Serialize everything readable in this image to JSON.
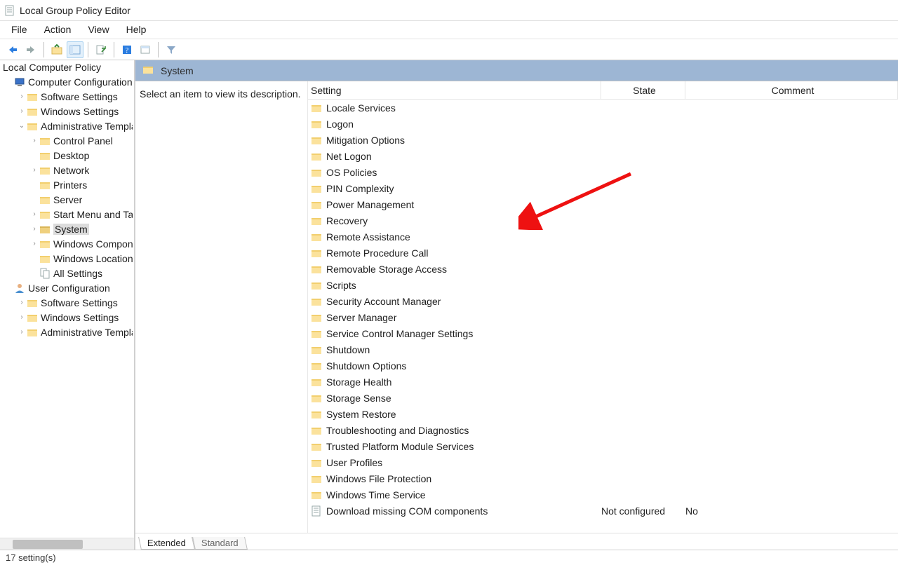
{
  "window_title": "Local Group Policy Editor",
  "menubar": [
    "File",
    "Action",
    "View",
    "Help"
  ],
  "tree_header": "Local Computer Policy",
  "tree": [
    {
      "lvl": 1,
      "exp": "",
      "icon": "computer",
      "label": "Computer Configuration"
    },
    {
      "lvl": 2,
      "exp": "closed",
      "icon": "folder",
      "label": "Software Settings"
    },
    {
      "lvl": 2,
      "exp": "closed",
      "icon": "folder",
      "label": "Windows Settings"
    },
    {
      "lvl": 2,
      "exp": "open",
      "icon": "folder",
      "label": "Administrative Templates"
    },
    {
      "lvl": 3,
      "exp": "closed",
      "icon": "folder",
      "label": "Control Panel"
    },
    {
      "lvl": 3,
      "exp": "",
      "icon": "folder",
      "label": "Desktop"
    },
    {
      "lvl": 3,
      "exp": "closed",
      "icon": "folder",
      "label": "Network"
    },
    {
      "lvl": 3,
      "exp": "",
      "icon": "folder",
      "label": "Printers"
    },
    {
      "lvl": 3,
      "exp": "",
      "icon": "folder",
      "label": "Server"
    },
    {
      "lvl": 3,
      "exp": "closed",
      "icon": "folder",
      "label": "Start Menu and Taskbar"
    },
    {
      "lvl": 3,
      "exp": "closed",
      "icon": "folder",
      "label": "System",
      "selected": true
    },
    {
      "lvl": 3,
      "exp": "closed",
      "icon": "folder",
      "label": "Windows Components"
    },
    {
      "lvl": 3,
      "exp": "",
      "icon": "folder",
      "label": "Windows Location"
    },
    {
      "lvl": 3,
      "exp": "",
      "icon": "sheet",
      "label": "All Settings"
    },
    {
      "lvl": 1,
      "exp": "",
      "icon": "user",
      "label": "User Configuration"
    },
    {
      "lvl": 2,
      "exp": "closed",
      "icon": "folder",
      "label": "Software Settings"
    },
    {
      "lvl": 2,
      "exp": "closed",
      "icon": "folder",
      "label": "Windows Settings"
    },
    {
      "lvl": 2,
      "exp": "closed",
      "icon": "folder",
      "label": "Administrative Templates"
    }
  ],
  "content_header": "System",
  "description_hint": "Select an item to view its description.",
  "columns": {
    "setting": "Setting",
    "state": "State",
    "comment": "Comment"
  },
  "rows": [
    {
      "icon": "folder",
      "setting": "Locale Services",
      "state": "",
      "comment": ""
    },
    {
      "icon": "folder",
      "setting": "Logon",
      "state": "",
      "comment": ""
    },
    {
      "icon": "folder",
      "setting": "Mitigation Options",
      "state": "",
      "comment": ""
    },
    {
      "icon": "folder",
      "setting": "Net Logon",
      "state": "",
      "comment": ""
    },
    {
      "icon": "folder",
      "setting": "OS Policies",
      "state": "",
      "comment": ""
    },
    {
      "icon": "folder",
      "setting": "PIN Complexity",
      "state": "",
      "comment": ""
    },
    {
      "icon": "folder",
      "setting": "Power Management",
      "state": "",
      "comment": ""
    },
    {
      "icon": "folder",
      "setting": "Recovery",
      "state": "",
      "comment": ""
    },
    {
      "icon": "folder",
      "setting": "Remote Assistance",
      "state": "",
      "comment": ""
    },
    {
      "icon": "folder",
      "setting": "Remote Procedure Call",
      "state": "",
      "comment": ""
    },
    {
      "icon": "folder",
      "setting": "Removable Storage Access",
      "state": "",
      "comment": ""
    },
    {
      "icon": "folder",
      "setting": "Scripts",
      "state": "",
      "comment": ""
    },
    {
      "icon": "folder",
      "setting": "Security Account Manager",
      "state": "",
      "comment": ""
    },
    {
      "icon": "folder",
      "setting": "Server Manager",
      "state": "",
      "comment": ""
    },
    {
      "icon": "folder",
      "setting": "Service Control Manager Settings",
      "state": "",
      "comment": ""
    },
    {
      "icon": "folder",
      "setting": "Shutdown",
      "state": "",
      "comment": ""
    },
    {
      "icon": "folder",
      "setting": "Shutdown Options",
      "state": "",
      "comment": ""
    },
    {
      "icon": "folder",
      "setting": "Storage Health",
      "state": "",
      "comment": ""
    },
    {
      "icon": "folder",
      "setting": "Storage Sense",
      "state": "",
      "comment": ""
    },
    {
      "icon": "folder",
      "setting": "System Restore",
      "state": "",
      "comment": ""
    },
    {
      "icon": "folder",
      "setting": "Troubleshooting and Diagnostics",
      "state": "",
      "comment": ""
    },
    {
      "icon": "folder",
      "setting": "Trusted Platform Module Services",
      "state": "",
      "comment": ""
    },
    {
      "icon": "folder",
      "setting": "User Profiles",
      "state": "",
      "comment": ""
    },
    {
      "icon": "folder",
      "setting": "Windows File Protection",
      "state": "",
      "comment": ""
    },
    {
      "icon": "folder",
      "setting": "Windows Time Service",
      "state": "",
      "comment": ""
    },
    {
      "icon": "page",
      "setting": "Download missing COM components",
      "state": "Not configured",
      "comment": "No"
    }
  ],
  "tabs": {
    "extended": "Extended",
    "standard": "Standard"
  },
  "statusbar": "17 setting(s)"
}
